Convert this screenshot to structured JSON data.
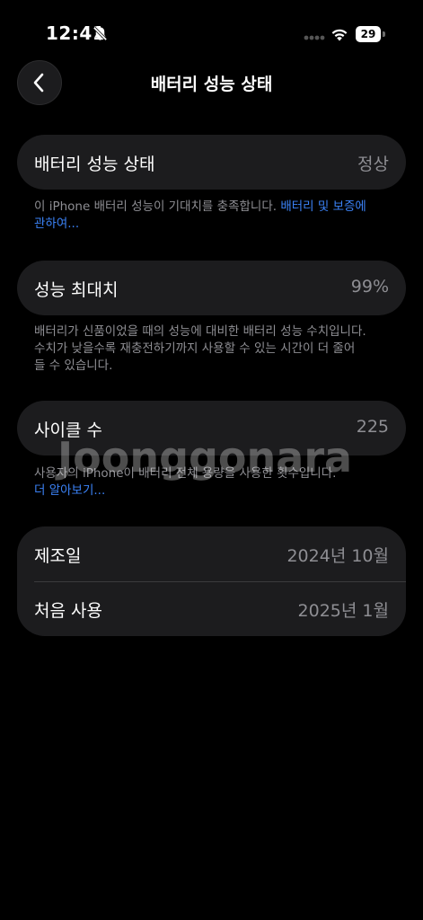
{
  "status_bar": {
    "time": "12:41",
    "battery_level": "29",
    "icons": [
      "bell-slash-icon",
      "cellular-signal-icon",
      "wifi-icon",
      "battery-icon"
    ]
  },
  "nav": {
    "title": "배터리 성능 상태",
    "back_icon": "chevron-left-icon"
  },
  "health": {
    "label": "배터리 성능 상태",
    "value": "정상",
    "footnote_text": "이 iPhone 배터리 성능이 기대치를 충족합니다. ",
    "footnote_link_line1": "배터리 및 보증에",
    "footnote_link_line2": "관하여..."
  },
  "capacity": {
    "label": "성능 최대치",
    "value": "99%",
    "footnote_line1": "배터리가 신품이었을 때의 성능에 대비한 배터리 성능 수치입니다.",
    "footnote_line2": "수치가 낮을수록 재충전하기까지 사용할 수 있는 시간이 더 줄어",
    "footnote_line3": "들 수 있습니다."
  },
  "cycles": {
    "label": "사이클 수",
    "value": "225",
    "footnote_text": "사용자의 iPhone이 배터리 전체 용량을 사용한 횟수입니다.",
    "footnote_link": "더 알아보기..."
  },
  "dates": {
    "manufacture_label": "제조일",
    "manufacture_value": "2024년 10월",
    "first_use_label": "처음 사용",
    "first_use_value": "2025년 1월"
  },
  "watermark": "Joonggonara",
  "colors": {
    "background": "#000000",
    "card": "#1c1c1e",
    "secondary_text": "#8e8e93",
    "link": "#3b82f6"
  }
}
